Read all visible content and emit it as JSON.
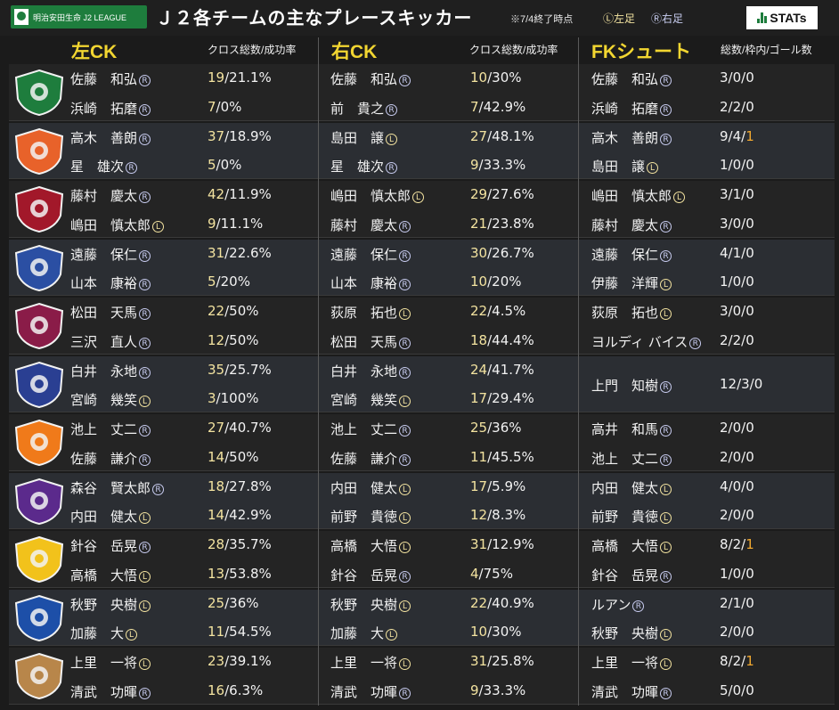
{
  "header": {
    "brand": "明治安田生命 J2 LEAGUE",
    "title": "Ｊ２各チームの主なプレースキッカー",
    "note": "※7/4終了時点",
    "left_foot": "Ⓛ左足",
    "right_foot": "Ⓡ右足",
    "stats_logo": "STATs"
  },
  "columns": {
    "left_ck": {
      "title": "左CK",
      "sub": "クロス総数/成功率"
    },
    "right_ck": {
      "title": "右CK",
      "sub": "クロス総数/成功率"
    },
    "fk": {
      "title": "FKシュート",
      "sub": "総数/枠内/ゴール数"
    }
  },
  "teams": [
    {
      "logo": "green-crest-logo",
      "color": "#1e7d3d",
      "rows": [
        {
          "lck_name": "佐藤　和弘",
          "lck_foot": "R",
          "lck_total": "19",
          "lck_rate": "/21.1%",
          "rck_name": "佐藤　和弘",
          "rck_foot": "R",
          "rck_total": "10",
          "rck_rate": "/30%",
          "fk_name": "佐藤　和弘",
          "fk_foot": "R",
          "fk_stat": "3/0/0",
          "fk_goal": ""
        },
        {
          "lck_name": "浜崎　拓磨",
          "lck_foot": "R",
          "lck_total": "7",
          "lck_rate": "/0%",
          "rck_name": "前　貴之",
          "rck_foot": "R",
          "rck_total": "7",
          "rck_rate": "/42.9%",
          "fk_name": "浜崎　拓磨",
          "fk_foot": "R",
          "fk_stat": "2/2/0",
          "fk_goal": ""
        }
      ]
    },
    {
      "logo": "orange-bird-logo",
      "color": "#e8622a",
      "rows": [
        {
          "lck_name": "高木　善朗",
          "lck_foot": "R",
          "lck_total": "37",
          "lck_rate": "/18.9%",
          "rck_name": "島田　譲",
          "rck_foot": "L",
          "rck_total": "27",
          "rck_rate": "/48.1%",
          "fk_name": "高木　善朗",
          "fk_foot": "R",
          "fk_stat": "9/4/",
          "fk_goal": "1"
        },
        {
          "lck_name": "星　雄次",
          "lck_foot": "R",
          "lck_total": "5",
          "lck_rate": "/0%",
          "rck_name": "星　雄次",
          "rck_foot": "R",
          "rck_total": "9",
          "rck_rate": "/33.3%",
          "fk_name": "島田　譲",
          "fk_foot": "L",
          "fk_stat": "1/0/0",
          "fk_goal": ""
        }
      ]
    },
    {
      "logo": "red-fleur-logo",
      "color": "#a2182a",
      "rows": [
        {
          "lck_name": "藤村　慶太",
          "lck_foot": "R",
          "lck_total": "42",
          "lck_rate": "/11.9%",
          "rck_name": "嶋田　慎太郎",
          "rck_foot": "L",
          "rck_total": "29",
          "rck_rate": "/27.6%",
          "fk_name": "嶋田　慎太郎",
          "fk_foot": "L",
          "fk_stat": "3/1/0",
          "fk_goal": ""
        },
        {
          "lck_name": "嶋田　慎太郎",
          "lck_foot": "L",
          "lck_total": "9",
          "lck_rate": "/11.1%",
          "rck_name": "藤村　慶太",
          "rck_foot": "R",
          "rck_total": "21",
          "rck_rate": "/23.8%",
          "fk_name": "藤村　慶太",
          "fk_foot": "R",
          "fk_stat": "3/0/0",
          "fk_goal": ""
        }
      ]
    },
    {
      "logo": "yellow-blue-logo",
      "color": "#2b4fa3",
      "rows": [
        {
          "lck_name": "遠藤　保仁",
          "lck_foot": "R",
          "lck_total": "31",
          "lck_rate": "/22.6%",
          "rck_name": "遠藤　保仁",
          "rck_foot": "R",
          "rck_total": "30",
          "rck_rate": "/26.7%",
          "fk_name": "遠藤　保仁",
          "fk_foot": "R",
          "fk_stat": "4/1/0",
          "fk_goal": ""
        },
        {
          "lck_name": "山本　康裕",
          "lck_foot": "R",
          "lck_total": "5",
          "lck_rate": "/20%",
          "rck_name": "山本　康裕",
          "rck_foot": "R",
          "rck_total": "10",
          "rck_rate": "/20%",
          "fk_name": "伊藤　洋輝",
          "fk_foot": "L",
          "fk_stat": "1/0/0",
          "fk_goal": ""
        }
      ]
    },
    {
      "logo": "purple-shield-logo",
      "color": "#8a1c48",
      "rows": [
        {
          "lck_name": "松田　天馬",
          "lck_foot": "R",
          "lck_total": "22",
          "lck_rate": "/50%",
          "rck_name": "荻原　拓也",
          "rck_foot": "L",
          "rck_total": "22",
          "rck_rate": "/4.5%",
          "fk_name": "荻原　拓也",
          "fk_foot": "L",
          "fk_stat": "3/0/0",
          "fk_goal": ""
        },
        {
          "lck_name": "三沢　直人",
          "lck_foot": "R",
          "lck_total": "12",
          "lck_rate": "/50%",
          "rck_name": "松田　天馬",
          "rck_foot": "R",
          "rck_total": "18",
          "rck_rate": "/44.4%",
          "fk_name": "ヨルディ バイス",
          "fk_foot": "R",
          "fk_stat": "2/2/0",
          "fk_goal": ""
        }
      ]
    },
    {
      "logo": "blue-red-bird-logo",
      "color": "#2a3f92",
      "merged_fk": true,
      "rows": [
        {
          "lck_name": "白井　永地",
          "lck_foot": "R",
          "lck_total": "35",
          "lck_rate": "/25.7%",
          "rck_name": "白井　永地",
          "rck_foot": "R",
          "rck_total": "24",
          "rck_rate": "/41.7%",
          "fk_name": "上門　知樹",
          "fk_foot": "R",
          "fk_stat": "12/3/0",
          "fk_goal": ""
        },
        {
          "lck_name": "宮崎　幾笑",
          "lck_foot": "L",
          "lck_total": "3",
          "lck_rate": "/100%",
          "rck_name": "宮崎　幾笑",
          "rck_foot": "L",
          "rck_total": "17",
          "rck_rate": "/29.4%",
          "fk_name": "",
          "fk_foot": "",
          "fk_stat": "",
          "fk_goal": ""
        }
      ]
    },
    {
      "logo": "orange-renofa-logo",
      "color": "#f07a1a",
      "rows": [
        {
          "lck_name": "池上　丈二",
          "lck_foot": "R",
          "lck_total": "27",
          "lck_rate": "/40.7%",
          "rck_name": "池上　丈二",
          "rck_foot": "R",
          "rck_total": "25",
          "rck_rate": "/36%",
          "fk_name": "高井　和馬",
          "fk_foot": "R",
          "fk_stat": "2/0/0",
          "fk_goal": ""
        },
        {
          "lck_name": "佐藤　謙介",
          "lck_foot": "R",
          "lck_total": "14",
          "lck_rate": "/50%",
          "rck_name": "佐藤　謙介",
          "rck_foot": "R",
          "rck_total": "11",
          "rck_rate": "/45.5%",
          "fk_name": "池上　丈二",
          "fk_foot": "R",
          "fk_stat": "2/0/0",
          "fk_goal": ""
        }
      ]
    },
    {
      "logo": "purple-green-logo",
      "color": "#5b2a8c",
      "rows": [
        {
          "lck_name": "森谷　賢太郎",
          "lck_foot": "R",
          "lck_total": "18",
          "lck_rate": "/27.8%",
          "rck_name": "内田　健太",
          "rck_foot": "L",
          "rck_total": "17",
          "rck_rate": "/5.9%",
          "fk_name": "内田　健太",
          "fk_foot": "L",
          "fk_stat": "4/0/0",
          "fk_goal": ""
        },
        {
          "lck_name": "内田　健太",
          "lck_foot": "L",
          "lck_total": "14",
          "lck_rate": "/42.9%",
          "rck_name": "前野　貴徳",
          "rck_foot": "L",
          "rck_total": "12",
          "rck_rate": "/8.3%",
          "fk_name": "前野　貴徳",
          "fk_foot": "L",
          "fk_stat": "2/0/0",
          "fk_goal": ""
        }
      ]
    },
    {
      "logo": "sun-star-logo",
      "color": "#f2c21b",
      "rows": [
        {
          "lck_name": "針谷　岳晃",
          "lck_foot": "R",
          "lck_total": "28",
          "lck_rate": "/35.7%",
          "rck_name": "高橋　大悟",
          "rck_foot": "L",
          "rck_total": "31",
          "rck_rate": "/12.9%",
          "fk_name": "高橋　大悟",
          "fk_foot": "L",
          "fk_stat": "8/2/",
          "fk_goal": "1"
        },
        {
          "lck_name": "高橋　大悟",
          "lck_foot": "L",
          "lck_total": "13",
          "lck_rate": "/53.8%",
          "rck_name": "針谷　岳晃",
          "rck_foot": "R",
          "rck_total": "4",
          "rck_rate": "/75%",
          "fk_name": "針谷　岳晃",
          "fk_foot": "R",
          "fk_stat": "1/0/0",
          "fk_goal": ""
        }
      ]
    },
    {
      "logo": "vvaren-logo",
      "color": "#1d4fa8",
      "rows": [
        {
          "lck_name": "秋野　央樹",
          "lck_foot": "L",
          "lck_total": "25",
          "lck_rate": "/36%",
          "rck_name": "秋野　央樹",
          "rck_foot": "L",
          "rck_total": "22",
          "rck_rate": "/40.9%",
          "fk_name": "ルアン",
          "fk_foot": "R",
          "fk_stat": "2/1/0",
          "fk_goal": ""
        },
        {
          "lck_name": "加藤　大",
          "lck_foot": "L",
          "lck_total": "11",
          "lck_rate": "/54.5%",
          "rck_name": "加藤　大",
          "rck_foot": "L",
          "rck_total": "10",
          "rck_rate": "/30%",
          "fk_name": "秋野　央樹",
          "fk_foot": "L",
          "fk_stat": "2/0/0",
          "fk_goal": ""
        }
      ]
    },
    {
      "logo": "gold-crown-logo",
      "color": "#b8864a",
      "rows": [
        {
          "lck_name": "上里　一将",
          "lck_foot": "L",
          "lck_total": "23",
          "lck_rate": "/39.1%",
          "rck_name": "上里　一将",
          "rck_foot": "L",
          "rck_total": "31",
          "rck_rate": "/25.8%",
          "fk_name": "上里　一将",
          "fk_foot": "L",
          "fk_stat": "8/2/",
          "fk_goal": "1"
        },
        {
          "lck_name": "清武　功暉",
          "lck_foot": "R",
          "lck_total": "16",
          "lck_rate": "/6.3%",
          "rck_name": "清武　功暉",
          "rck_foot": "R",
          "rck_total": "9",
          "rck_rate": "/33.3%",
          "fk_name": "清武　功暉",
          "fk_foot": "R",
          "fk_stat": "5/0/0",
          "fk_goal": ""
        }
      ]
    }
  ]
}
